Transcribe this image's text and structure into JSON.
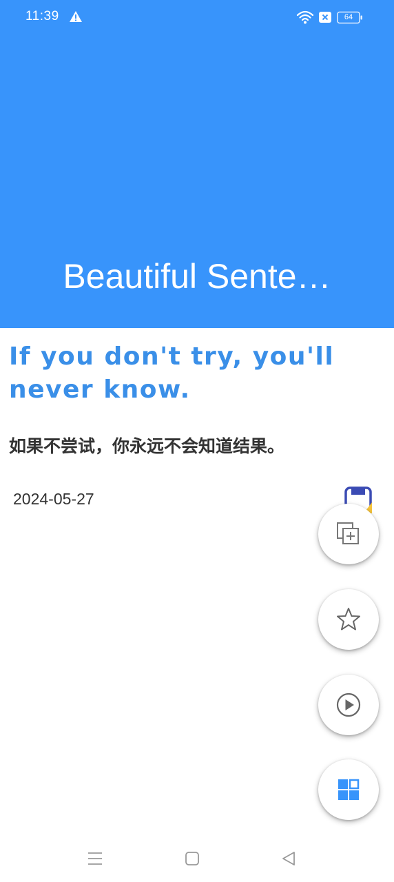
{
  "status_bar": {
    "time": "11:39",
    "alert_icon": "warning-triangle-icon",
    "wifi_icon": "wifi-icon",
    "sim_icon": "no-sim-icon",
    "battery_level": "64"
  },
  "header": {
    "title": "Beautiful Sente…",
    "background_color": "#3894fb"
  },
  "sentence": {
    "english": "If you don't try, you'll never know.",
    "chinese": "如果不尝试，你永远不会知道结果。",
    "date": "2024-05-27",
    "english_color": "#3a8fe8"
  },
  "actions": [
    {
      "name": "copy",
      "icon": "copy-add-icon"
    },
    {
      "name": "favorite",
      "icon": "star-icon"
    },
    {
      "name": "play",
      "icon": "play-icon"
    },
    {
      "name": "grid",
      "icon": "grid-icon"
    }
  ],
  "nav": {
    "menu_icon": "menu-icon",
    "home_icon": "home-icon",
    "back_icon": "back-icon"
  }
}
